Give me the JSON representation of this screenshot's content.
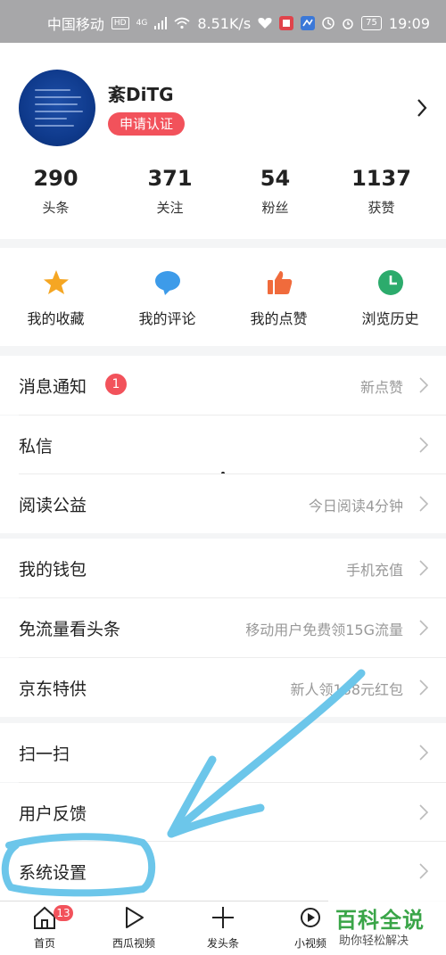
{
  "status_bar": {
    "carrier": "中国移动",
    "hd": "HD",
    "net": "4G",
    "speed": "8.51K/s",
    "battery": "75",
    "time": "19:09"
  },
  "profile": {
    "username": "紊DiTG",
    "cert_label": "申请认证"
  },
  "stats": [
    {
      "value": "290",
      "label": "头条"
    },
    {
      "value": "371",
      "label": "关注"
    },
    {
      "value": "54",
      "label": "粉丝"
    },
    {
      "value": "1137",
      "label": "获赞"
    }
  ],
  "quick_actions": [
    {
      "label": "我的收藏",
      "icon": "star-icon",
      "color": "#f5a623"
    },
    {
      "label": "我的评论",
      "icon": "comment-icon",
      "color": "#3d9be9"
    },
    {
      "label": "我的点赞",
      "icon": "thumbs-up-icon",
      "color": "#f06b3c"
    },
    {
      "label": "浏览历史",
      "icon": "clock-icon",
      "color": "#2cab6c"
    }
  ],
  "menu": [
    {
      "label": "消息通知",
      "value": "新点赞",
      "badge": "1"
    },
    {
      "label": "私信",
      "value": ""
    },
    {
      "label": "阅读公益",
      "value": "今日阅读4分钟"
    },
    {
      "label": "我的钱包",
      "value": "手机充值"
    },
    {
      "label": "免流量看头条",
      "value": "移动用户免费领15G流量"
    },
    {
      "label": "京东特供",
      "value": "新人领188元红包"
    },
    {
      "label": "扫一扫",
      "value": ""
    },
    {
      "label": "用户反馈",
      "value": ""
    },
    {
      "label": "系统设置",
      "value": ""
    }
  ],
  "tabs": [
    {
      "label": "首页",
      "icon": "home-icon",
      "badge": "13"
    },
    {
      "label": "西瓜视频",
      "icon": "play-icon"
    },
    {
      "label": "发头条",
      "icon": "plus-icon"
    },
    {
      "label": "小视频",
      "icon": "short-video-icon"
    }
  ],
  "watermark": {
    "title": "百科全说",
    "subtitle": "助你轻松解决"
  },
  "colors": {
    "accent": "#f2525b",
    "annotation": "#6cc6ea"
  }
}
